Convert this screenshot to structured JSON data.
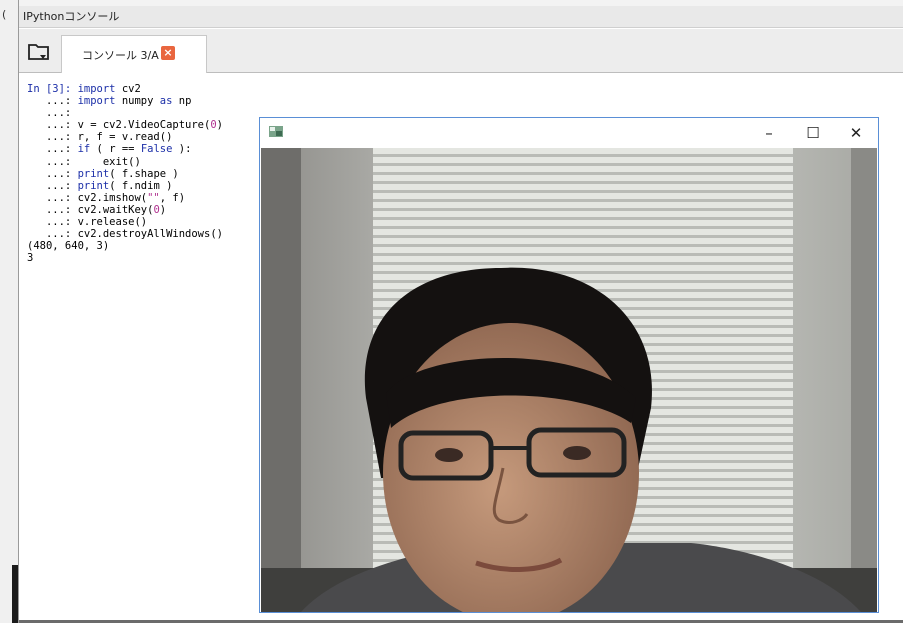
{
  "window": {
    "title": "IPythonコンソール"
  },
  "left": {
    "paren": "("
  },
  "tab": {
    "label": "コンソール 3/A",
    "close": "×"
  },
  "console": {
    "lines": [
      [
        {
          "t": "In [3]: ",
          "c": "in"
        },
        {
          "t": "import",
          "c": "kw"
        },
        {
          "t": " cv2",
          "c": ""
        }
      ],
      [
        {
          "t": "   ...: ",
          "c": ""
        },
        {
          "t": "import",
          "c": "kw"
        },
        {
          "t": " numpy ",
          "c": ""
        },
        {
          "t": "as",
          "c": "kw"
        },
        {
          "t": " np",
          "c": ""
        }
      ],
      [
        {
          "t": "   ...:",
          "c": ""
        }
      ],
      [
        {
          "t": "   ...: v = cv2.VideoCapture(",
          "c": ""
        },
        {
          "t": "0",
          "c": "num"
        },
        {
          "t": ")",
          "c": ""
        }
      ],
      [
        {
          "t": "   ...: r, f = v.read()",
          "c": ""
        }
      ],
      [
        {
          "t": "   ...: ",
          "c": ""
        },
        {
          "t": "if",
          "c": "kw"
        },
        {
          "t": " ( r == ",
          "c": ""
        },
        {
          "t": "False",
          "c": "kw"
        },
        {
          "t": " ):",
          "c": ""
        }
      ],
      [
        {
          "t": "   ...:     exit()",
          "c": ""
        }
      ],
      [
        {
          "t": "   ...: ",
          "c": ""
        },
        {
          "t": "print",
          "c": "kw"
        },
        {
          "t": "( f.shape )",
          "c": ""
        }
      ],
      [
        {
          "t": "   ...: ",
          "c": ""
        },
        {
          "t": "print",
          "c": "kw"
        },
        {
          "t": "( f.ndim )",
          "c": ""
        }
      ],
      [
        {
          "t": "   ...: cv2.imshow(",
          "c": ""
        },
        {
          "t": "\"\"",
          "c": "str"
        },
        {
          "t": ", f)",
          "c": ""
        }
      ],
      [
        {
          "t": "   ...: cv2.waitKey(",
          "c": ""
        },
        {
          "t": "0",
          "c": "num"
        },
        {
          "t": ")",
          "c": ""
        }
      ],
      [
        {
          "t": "   ...: v.release()",
          "c": ""
        }
      ],
      [
        {
          "t": "   ...: cv2.destroyAllWindows()",
          "c": ""
        }
      ],
      [
        {
          "t": "(480, 640, 3)",
          "c": ""
        }
      ],
      [
        {
          "t": "3",
          "c": ""
        }
      ]
    ]
  },
  "cv_window": {
    "minimize": "–",
    "maximize": "☐",
    "close": "✕"
  },
  "icons": {
    "folder": "folder-icon",
    "close": "close-icon",
    "app": "cv-window-icon"
  },
  "colors": {
    "accent": "#5a8fd6",
    "keyword": "#1c2fa8",
    "string": "#b0318f",
    "tab_close": "#e9663f"
  }
}
